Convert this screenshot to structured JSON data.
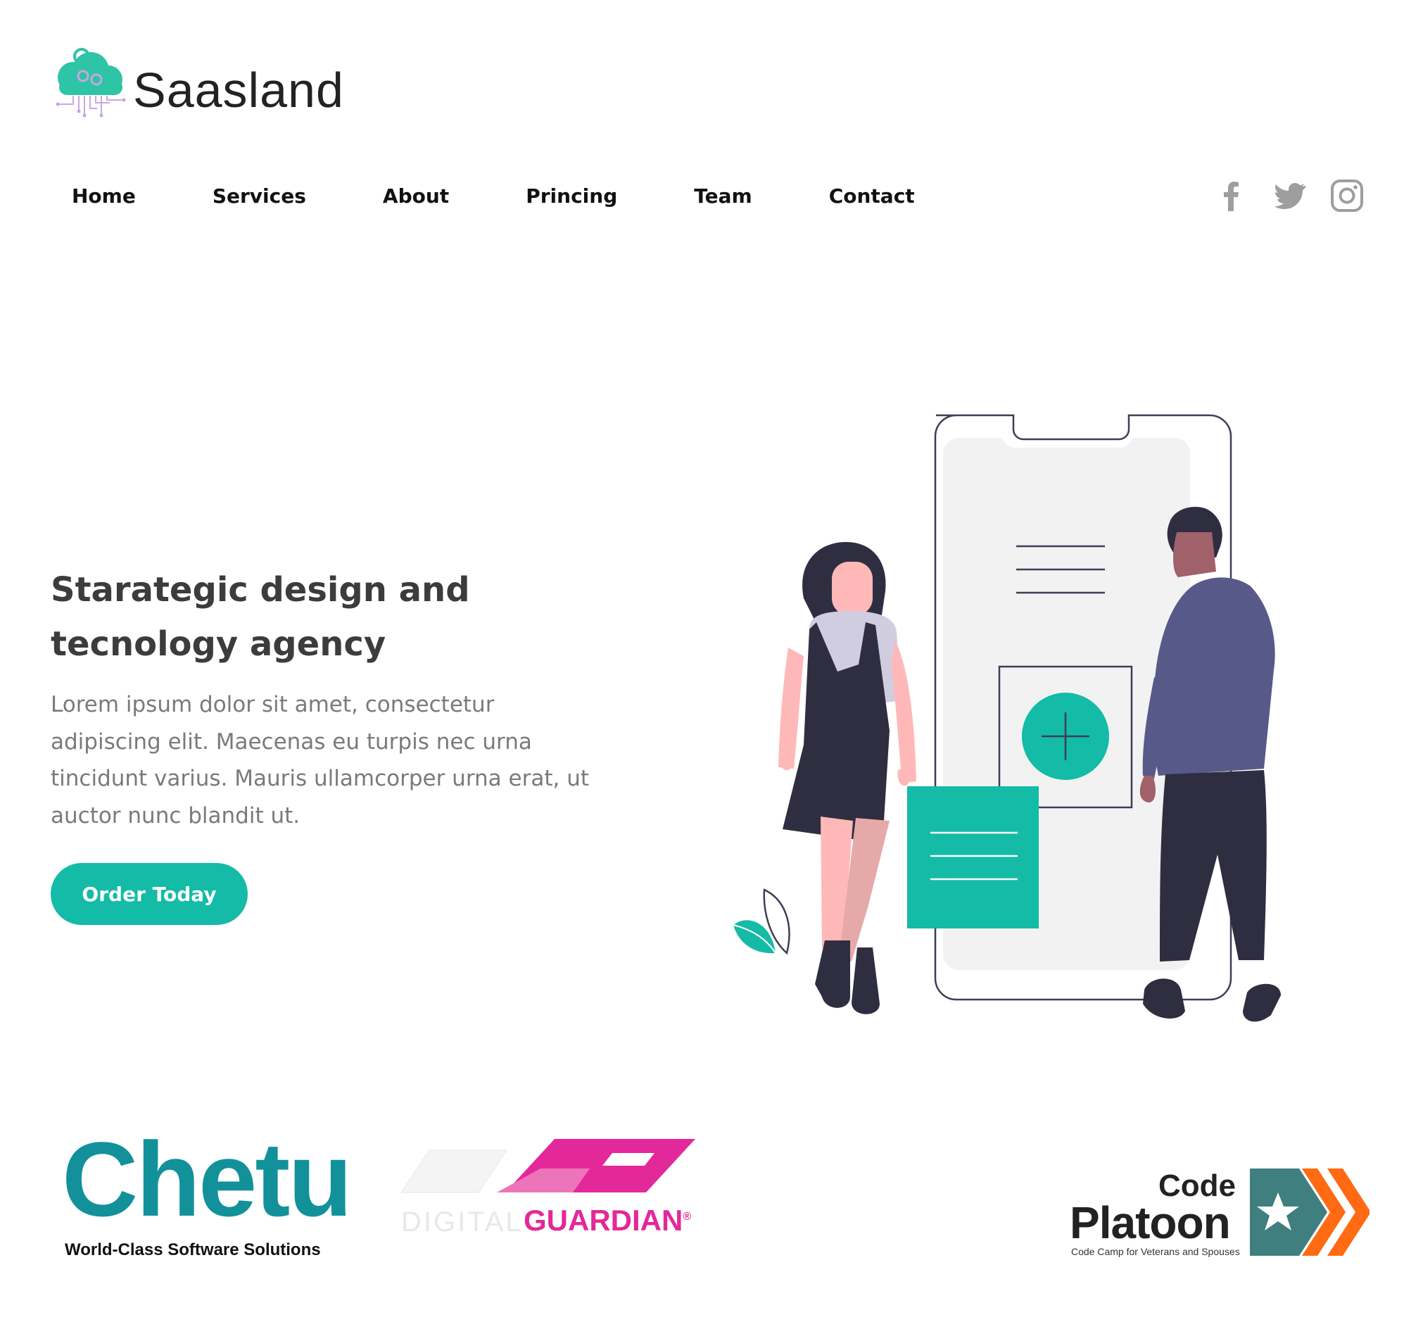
{
  "brand": {
    "name": "Saasland",
    "logo_colors": {
      "cloud": "#2ec4a6",
      "circuit": "#c9a6e0"
    }
  },
  "nav": {
    "items": [
      {
        "label": "Home"
      },
      {
        "label": "Services"
      },
      {
        "label": "About"
      },
      {
        "label": "Princing"
      },
      {
        "label": "Team"
      },
      {
        "label": "Contact"
      }
    ]
  },
  "social": {
    "icons": [
      "facebook-icon",
      "twitter-icon",
      "instagram-icon"
    ],
    "color": "#9e9e9e"
  },
  "hero": {
    "title_line1": "Starategic design and",
    "title_line2": "tecnology agency",
    "text": "Lorem ipsum dolor sit amet, consectetur adipiscing elit. Maecenas eu turpis nec urna tincidunt varius. Mauris ullamcorper urna erat, ut auctor nunc blandit ut.",
    "cta_label": "Order Today",
    "accent": "#14bba6"
  },
  "clients": {
    "chetu": {
      "name": "Chetu",
      "tagline": "World-Class Software Solutions"
    },
    "guardian": {
      "prefix": "DIGITAL",
      "name": "GUARDIAN",
      "mark": "®"
    },
    "platoon": {
      "line1": "Code",
      "line2": "Platoon",
      "tagline": "Code Camp for Veterans and Spouses"
    }
  }
}
